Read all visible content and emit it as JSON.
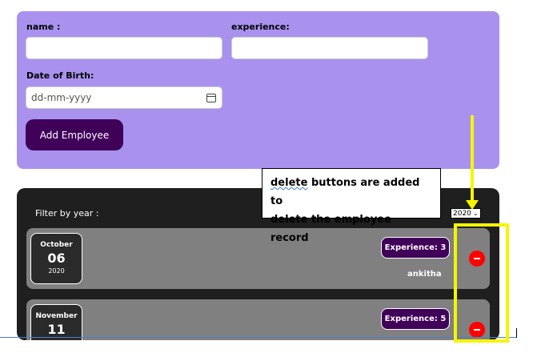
{
  "form": {
    "name_label": "name :",
    "name_value": "",
    "experience_label": "experience:",
    "experience_value": "",
    "dob_label": "Date of Birth:",
    "dob_placeholder": "dd-mm-yyyy",
    "add_button": "Add Employee"
  },
  "callout": {
    "word1": "delete",
    "line1_rest": " buttons are added to",
    "line2": "delete the employee record"
  },
  "filter": {
    "label": "Filter by year :",
    "selected_year": "2020"
  },
  "employees": [
    {
      "month": "October",
      "day": "06",
      "year": "2020",
      "experience": "Experience: 3",
      "name": "ankitha"
    },
    {
      "month": "November",
      "day": "11",
      "year": "",
      "experience": "Experience: 5",
      "name": ""
    }
  ],
  "colors": {
    "form_bg": "#a892ee",
    "primary_button": "#40005a",
    "list_bg": "#1f1f1f",
    "item_bg": "#808080",
    "delete_button": "#ff0000",
    "annotation": "#f5f500"
  },
  "icons": {
    "calendar": "calendar-icon",
    "delete": "minus-circle-icon",
    "dropdown": "chevron-down-icon"
  }
}
